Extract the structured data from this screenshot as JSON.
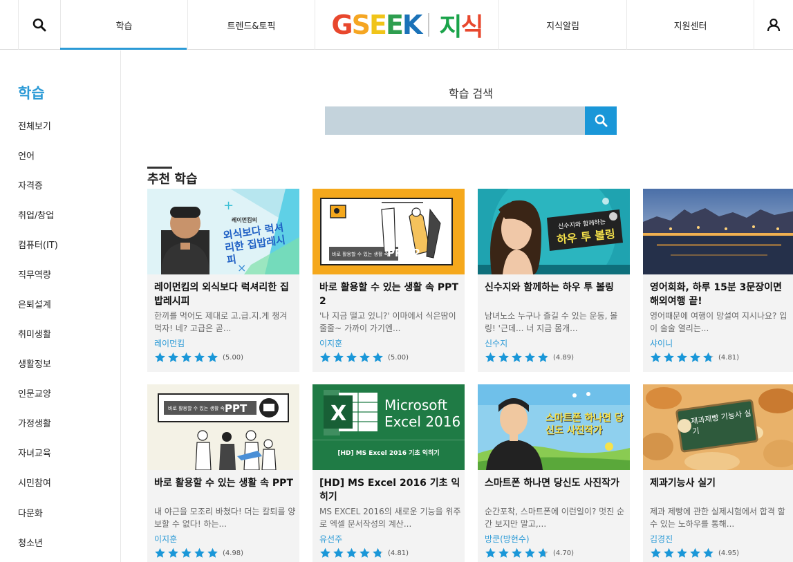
{
  "nav": {
    "tabs": [
      "학습",
      "트렌드&토픽",
      "지식알림",
      "지원센터"
    ],
    "logo_text": "GSEEK",
    "logo_kr": "지식",
    "accent": "#2b9ad6"
  },
  "sidebar": {
    "title": "학습",
    "items": [
      "전체보기",
      "언어",
      "자격증",
      "취업/창업",
      "컴퓨터(IT)",
      "직무역량",
      "은퇴설계",
      "취미생활",
      "생활정보",
      "인문교양",
      "가정생활",
      "자녀교육",
      "시민참여",
      "다문화",
      "청소년"
    ]
  },
  "search": {
    "label": "학습 검색",
    "placeholder": ""
  },
  "section": {
    "title": "추천 학습"
  },
  "cards": [
    {
      "title": "레이먼킴의 외식보다 럭셔리한 집밥레시피",
      "desc": "한끼를 먹어도 제대로 고.급.지.게 챙겨 먹자! 네? 고급은 곧...",
      "author": "레이먼킴",
      "rating": 5.0,
      "score": "(5.00)",
      "thumb_text": "외식보다 럭셔리한 집밥레시피",
      "thumb_sub": "레이먼킴의"
    },
    {
      "title": "바로 활용할 수 있는 생활 속 PPT 2",
      "desc": "'나 지금 떨고 있니?' 이마에서 식은땀이 줄줄~ 가까이 가기엔...",
      "author": "이지훈",
      "rating": 5.0,
      "score": "(5.00)",
      "thumb_text": "PPT 2",
      "thumb_sub": "바로 활용할 수 있는 생활 속"
    },
    {
      "title": "신수지와 함께하는 하우 투 볼링",
      "desc": "남녀노소 누구나 즐길 수 있는 운동, 볼링! '근데... 너 지금 몸개...",
      "author": "신수지",
      "rating": 4.89,
      "score": "(4.89)",
      "thumb_text": "하우 투 볼링",
      "thumb_sub": "신수지와 함께하는"
    },
    {
      "title": "영어회화, 하루 15분 3문장이면 해외여행 끝!",
      "desc": "영어때문에 여행이 망설여 지시나요? 입이 술술 열리는...",
      "author": "샤이니",
      "rating": 4.81,
      "score": "(4.81)",
      "thumb_text": "",
      "thumb_sub": ""
    },
    {
      "title": "바로 활용할 수 있는 생활 속 PPT",
      "desc": "내 야근을 모조리 바쳤다! 더는 칼퇴를 양보할 수 없다! 하는...",
      "author": "이지훈",
      "rating": 4.98,
      "score": "(4.98)",
      "thumb_text": "PPT",
      "thumb_sub": "바로 활용할 수 있는 생활 속"
    },
    {
      "title": "[HD] MS Excel 2016 기초 익히기",
      "desc": "MS EXCEL 2016의 새로운 기능을 위주로 엑셀 문서작성의 계산...",
      "author": "유선주",
      "rating": 4.81,
      "score": "(4.81)",
      "thumb_text": "Microsoft Excel 2016",
      "thumb_sub": "[HD] MS Excel 2016 기초 익히기"
    },
    {
      "title": "스마트폰 하나면 당신도 사진작가",
      "desc": "순간포착, 스마트폰에 이런일이? 멋진 순간 보지만 말고,...",
      "author": "방쿤(방현수)",
      "rating": 4.7,
      "score": "(4.70)",
      "thumb_text": "스마트폰 하나면 당신도 사진작가",
      "thumb_sub": ""
    },
    {
      "title": "제과기능사 실기",
      "desc": "제과 제빵에 관한 실제시험에서 합격 할 수 있는 노하우를 통해...",
      "author": "김경진",
      "rating": 4.95,
      "score": "(4.95)",
      "thumb_text": "제과제빵 기능사 실기",
      "thumb_sub": ""
    }
  ]
}
